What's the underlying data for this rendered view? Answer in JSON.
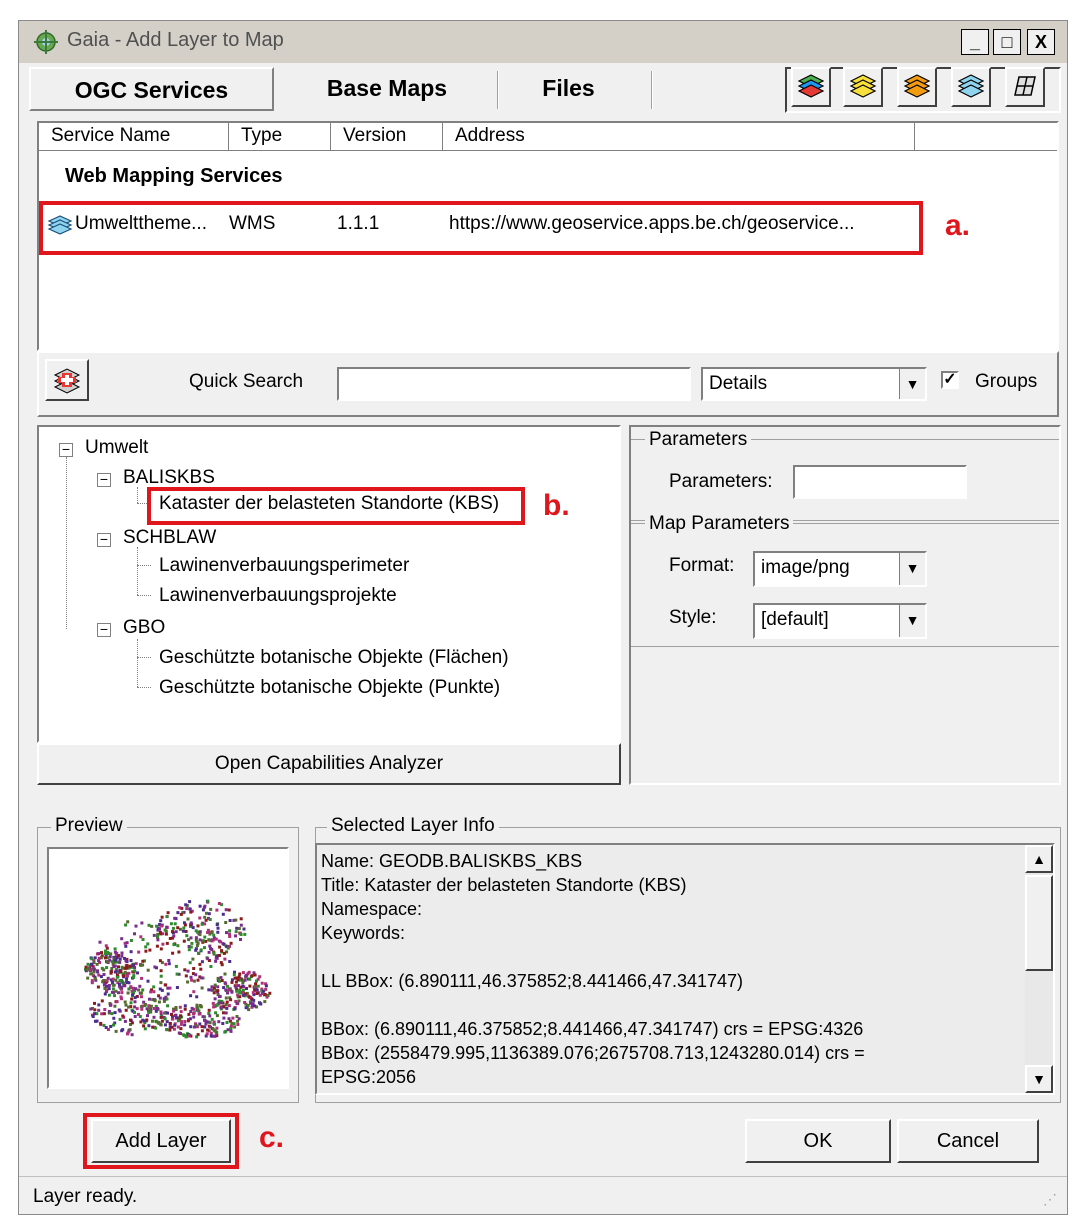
{
  "window": {
    "title": "Gaia - Add Layer to Map",
    "minimize": "_",
    "maximize": "□",
    "close": "X"
  },
  "tabs": [
    "OGC Services",
    "Base Maps",
    "Files"
  ],
  "service_table": {
    "columns": [
      "Service Name",
      "Type",
      "Version",
      "Address"
    ],
    "group_label": "Web Mapping Services",
    "rows": [
      {
        "name": "Umwelttheme...",
        "type": "WMS",
        "version": "1.1.1",
        "address": "https://www.geoservice.apps.be.ch/geoservice..."
      }
    ]
  },
  "quick_search": {
    "label": "Quick Search",
    "value": "",
    "mode": "Details",
    "groups_label": "Groups",
    "groups_checked": true
  },
  "tree": {
    "root": "Umwelt",
    "nodes": [
      {
        "label": "BALISKBS",
        "children": [
          "Kataster der belasteten Standorte (KBS)"
        ]
      },
      {
        "label": "SCHBLAW",
        "children": [
          "Lawinenverbauungsperimeter",
          "Lawinenverbauungsprojekte"
        ]
      },
      {
        "label": "GBO",
        "children": [
          "Geschützte botanische Objekte (Flächen)",
          "Geschützte botanische Objekte (Punkte)"
        ]
      }
    ],
    "analyzer_button": "Open Capabilities Analyzer"
  },
  "parameters": {
    "group_title": "Parameters",
    "label": "Parameters:",
    "value": ""
  },
  "map_parameters": {
    "group_title": "Map Parameters",
    "format_label": "Format:",
    "format_value": "image/png",
    "style_label": "Style:",
    "style_value": "[default]"
  },
  "preview": {
    "title": "Preview"
  },
  "layer_info": {
    "title": "Selected Layer Info",
    "lines": [
      "Name: GEODB.BALISKBS_KBS",
      "Title: Kataster der belasteten Standorte (KBS)",
      "Namespace:",
      "Keywords:",
      "",
      "LL BBox: (6.890111,46.375852;8.441466,47.341747)",
      "",
      "BBox: (6.890111,46.375852;8.441466,47.341747) crs = EPSG:4326",
      "BBox: (2558479.995,1136389.076;2675708.713,1243280.014) crs =",
      "EPSG:2056"
    ]
  },
  "buttons": {
    "add_layer": "Add Layer",
    "ok": "OK",
    "cancel": "Cancel"
  },
  "status": "Layer ready.",
  "annotations": {
    "a": "a.",
    "b": "b.",
    "c": "c."
  },
  "colors": {
    "annotation_red": "#e0161d",
    "window_bg": "#f0f0f0"
  }
}
